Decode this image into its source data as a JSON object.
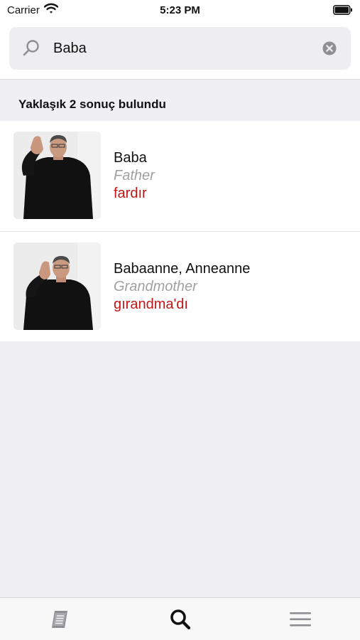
{
  "status_bar": {
    "carrier": "Carrier",
    "time": "5:23 PM"
  },
  "search": {
    "value": "Baba",
    "placeholder": ""
  },
  "result_count": "Yaklaşık 2 sonuç bulundu",
  "results": [
    {
      "term": "Baba",
      "translation": "Father",
      "pronunciation": "fardır"
    },
    {
      "term": "Babaanne, Anneanne",
      "translation": "Grandmother",
      "pronunciation": "gırandma'dı"
    }
  ],
  "tabs": [
    {
      "icon": "book-icon",
      "active": false
    },
    {
      "icon": "search-icon",
      "active": true
    },
    {
      "icon": "menu-icon",
      "active": false
    }
  ],
  "colors": {
    "accent_red": "#c41616",
    "secondary_gray": "#a0a0a0",
    "background": "#efeff4"
  }
}
